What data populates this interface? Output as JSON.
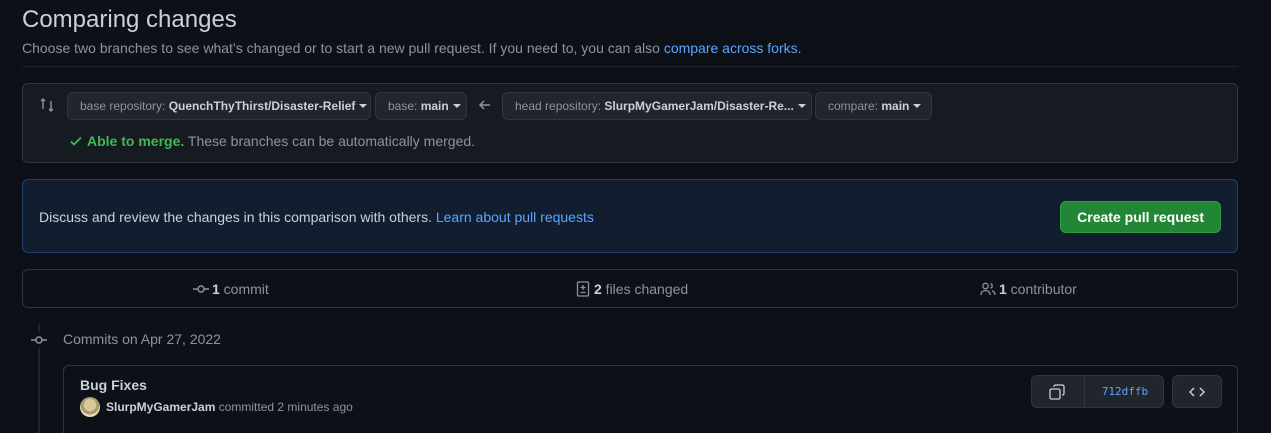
{
  "header": {
    "title": "Comparing changes",
    "subtitle": "Choose two branches to see what’s changed or to start a new pull request. If you need to, you can also ",
    "subtitle_link": "compare across forks",
    "subtitle_end": "."
  },
  "compare": {
    "base_repo_label": "base repository: ",
    "base_repo_value": "QuenchThyThirst/Disaster-Relief",
    "base_label": "base: ",
    "base_value": "main",
    "head_repo_label": "head repository: ",
    "head_repo_value": "SlurpMyGamerJam/Disaster-Re...",
    "compare_label": "compare: ",
    "compare_value": "main",
    "merge_ok": "Able to merge.",
    "merge_text": " These branches can be automatically merged."
  },
  "discuss": {
    "text": "Discuss and review the changes in this comparison with others. ",
    "link": "Learn about pull requests",
    "button": "Create pull request"
  },
  "stats": {
    "commits_count": "1",
    "commits_label": " commit",
    "files_count": "2",
    "files_label": " files changed",
    "contributors_count": "1",
    "contributors_label": " contributor"
  },
  "timeline": {
    "date": "Commits on Apr 27, 2022",
    "commit": {
      "title": "Bug Fixes",
      "author": "SlurpMyGamerJam",
      "meta": " committed 2 minutes ago",
      "sha": "712dffb"
    }
  },
  "colors": {
    "accent": "#58a6ff",
    "success": "#3fb950",
    "primary_button": "#238636"
  }
}
